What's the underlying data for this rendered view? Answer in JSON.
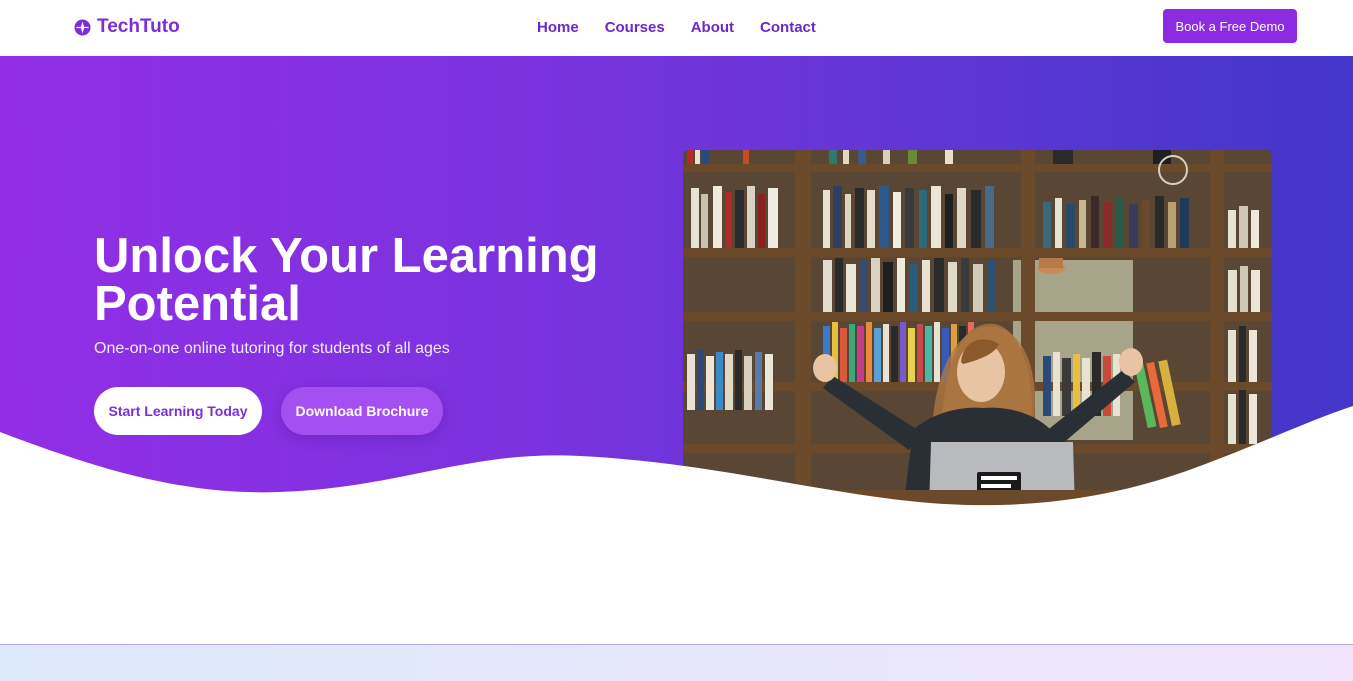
{
  "brand": {
    "name": "TechTuto",
    "icon": "compass-icon",
    "color": "#7c2fd6"
  },
  "nav": {
    "links": [
      {
        "label": "Home"
      },
      {
        "label": "Courses"
      },
      {
        "label": "About"
      },
      {
        "label": "Contact"
      }
    ],
    "cta_label": "Book a Free Demo"
  },
  "hero": {
    "title": "Unlock Your Learning Potential",
    "subtitle": "One-on-one online tutoring for students of all ages",
    "primary_button": "Start Learning Today",
    "secondary_button": "Download Brochure",
    "image_alt": "Girl celebrating in front of a laptop with bookshelves behind her",
    "gradient": [
      "#922ee6",
      "#4336c8"
    ]
  },
  "colors": {
    "accent": "#8b2be2",
    "nav_text": "#6d28c9"
  }
}
